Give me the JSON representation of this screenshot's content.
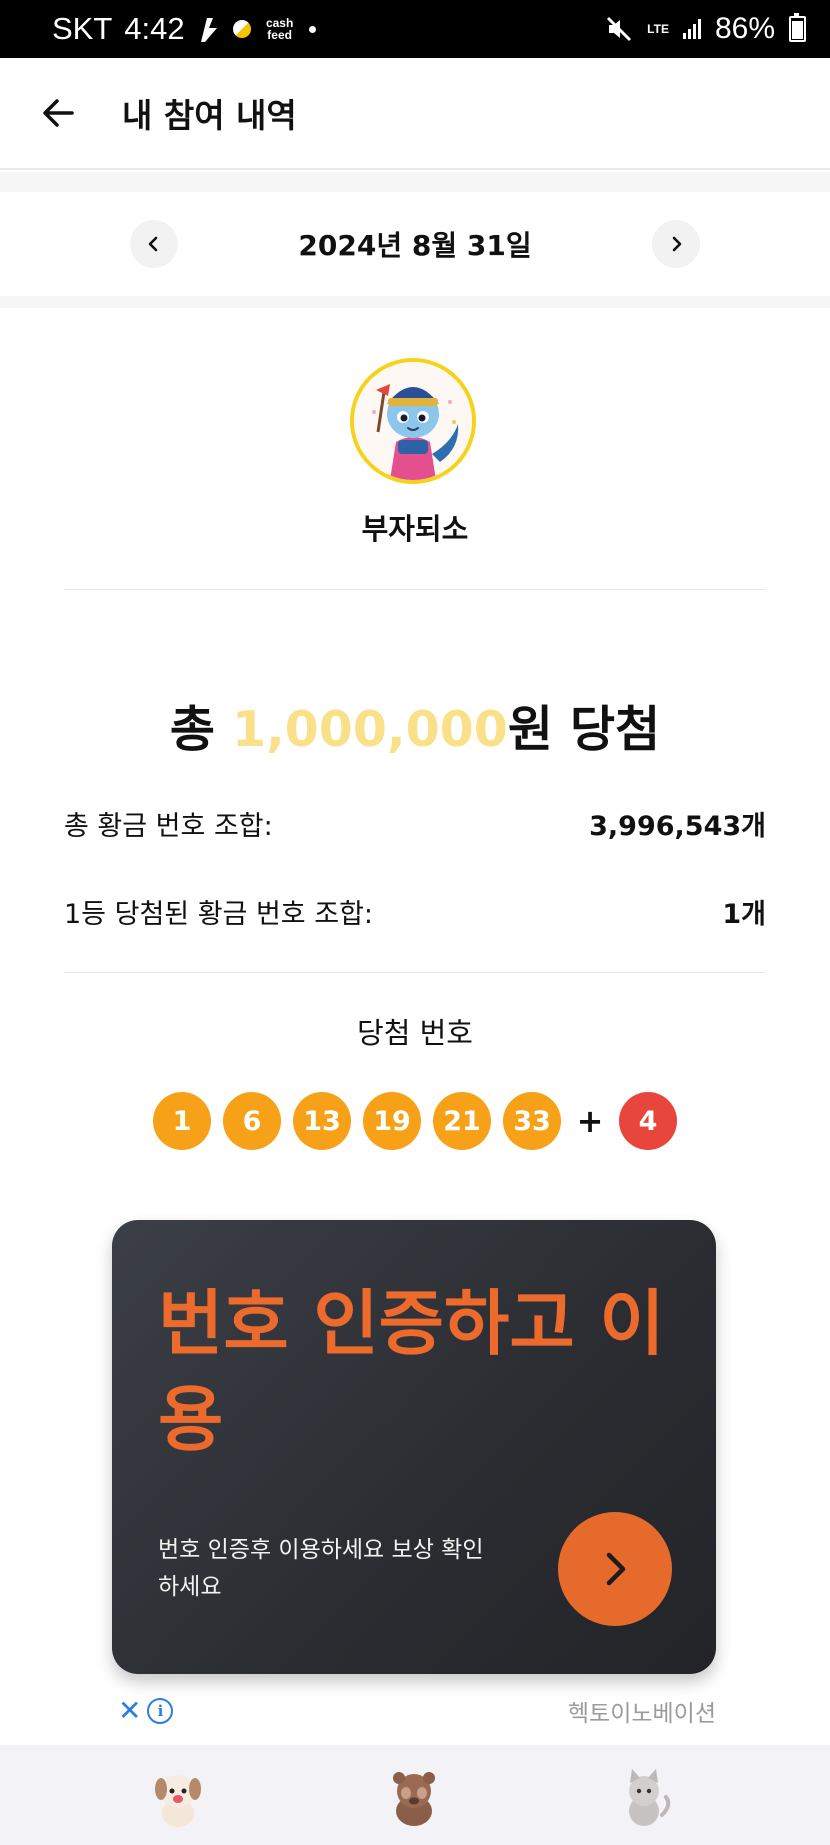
{
  "status_bar": {
    "carrier": "SKT",
    "time": "4:42",
    "app_badge": "cash feed",
    "network": "LTE",
    "battery": "86%"
  },
  "header": {
    "title": "내 참여 내역"
  },
  "date_nav": {
    "date": "2024년 8월 31일"
  },
  "profile": {
    "name": "부자되소"
  },
  "prize": {
    "prefix": "총",
    "amount": "1,000,000",
    "suffix": "원 당첨"
  },
  "stats": [
    {
      "label": "총 황금 번호 조합:",
      "value": "3,996,543개"
    },
    {
      "label": "1등 당첨된 황금 번호 조합:",
      "value": "1개"
    }
  ],
  "winning": {
    "label": "당첨 번호",
    "numbers": [
      "1",
      "6",
      "13",
      "19",
      "21",
      "33"
    ],
    "plus": "+",
    "bonus": "4",
    "ball_color": "#f6a117",
    "bonus_color": "#e8453c"
  },
  "ad": {
    "title": "번호 인증하고 이용",
    "subtitle": "번호 인증후 이용하세요 보상 확인하세요",
    "advertiser": "헥토이노베이션",
    "accent": "#ec6a2c"
  },
  "bottom_nav": [
    "dog-character-icon",
    "bear-character-icon",
    "cat-character-icon"
  ]
}
